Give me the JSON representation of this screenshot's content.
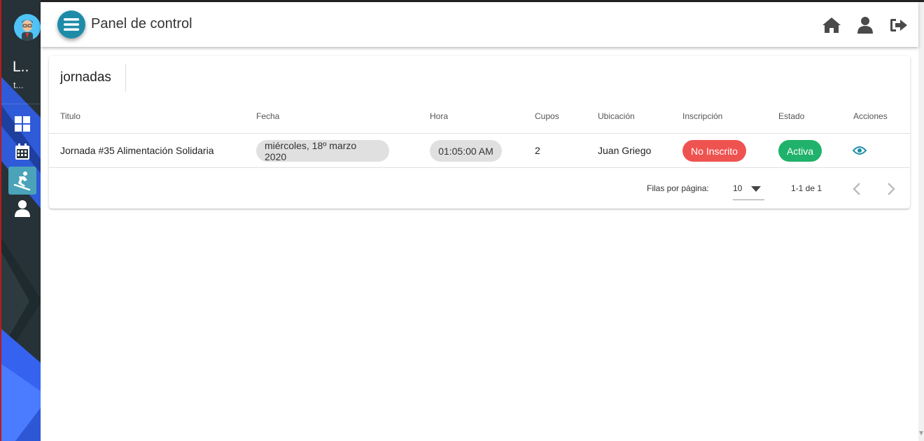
{
  "header": {
    "title": "Panel de control"
  },
  "user": {
    "name": "L..",
    "subtitle": "t..."
  },
  "card": {
    "title": "jornadas",
    "columns": [
      "Titulo",
      "Fecha",
      "Hora",
      "Cupos",
      "Ubicación",
      "Inscripción",
      "Estado",
      "Acciones"
    ],
    "rows": [
      {
        "titulo": "Jornada #35 Alimentación Solidaria",
        "fecha": "miércoles, 18º marzo 2020",
        "hora": "01:05:00 AM",
        "cupos": "2",
        "ubicacion": "Juan Griego",
        "inscripcion": "No Inscrito",
        "estado": "Activa"
      }
    ],
    "footer": {
      "rows_per_page_label": "Filas por página:",
      "rows_per_page_value": "10",
      "range": "1-1 de 1"
    }
  },
  "colors": {
    "accent": "#1e8ca8",
    "sidebar_bg": "#263238",
    "active_nav": "#4aa3b8",
    "no_inscrito": "#ef5350",
    "activa": "#20b26b",
    "chip_grey": "#e0e0e0"
  },
  "icons": {
    "sidebar": [
      "dashboard-icon",
      "calendar-icon",
      "snowboard-icon",
      "user-icon"
    ],
    "header": [
      "home-icon",
      "user-icon",
      "logout-icon"
    ]
  }
}
